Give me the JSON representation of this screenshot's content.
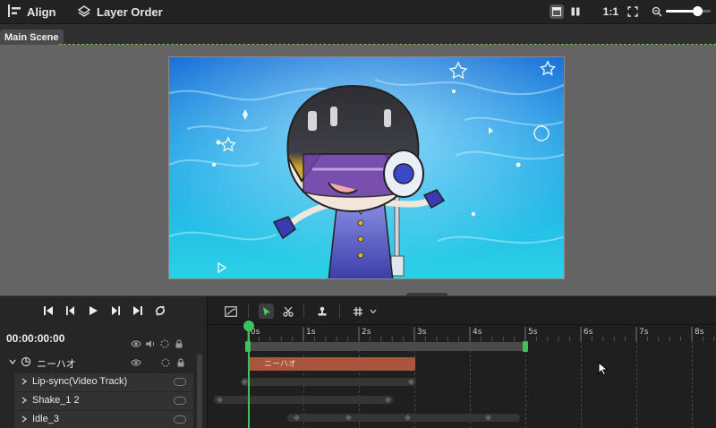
{
  "toolbar": {
    "align_label": "Align",
    "layer_order_label": "Layer Order",
    "zoom_ratio": "1:1",
    "zoom_level": 0.7,
    "icons": [
      "align-icon",
      "layer-order-icon",
      "layout-single-icon",
      "layout-split-icon",
      "fit-screen-icon",
      "zoom-icon"
    ]
  },
  "scene": {
    "tab_label": "Main Scene"
  },
  "playback": {
    "timecode": "00:00:00:00",
    "controls": [
      "skip-start",
      "prev-frame",
      "play",
      "next-frame",
      "skip-end",
      "loop"
    ]
  },
  "layers": [
    {
      "label": "ニーハオ",
      "type": "group"
    },
    {
      "label": "Lip-sync(Video Track)",
      "type": "track"
    },
    {
      "label": "Shake_1 2",
      "type": "track"
    },
    {
      "label": "Idle_3",
      "type": "track"
    }
  ],
  "timeline": {
    "ruler": [
      "0s",
      "1s",
      "2s",
      "3s",
      "4s",
      "5s",
      "6s",
      "7s",
      "8s"
    ],
    "clip_label": "ニーハオ",
    "range_end_seconds": 5,
    "playhead_seconds": 0
  },
  "colors": {
    "accent_green": "#3ec25b",
    "clip_color": "#a9563d",
    "canvas_bg": "#646464",
    "panel_bg": "#1f1f1f"
  }
}
